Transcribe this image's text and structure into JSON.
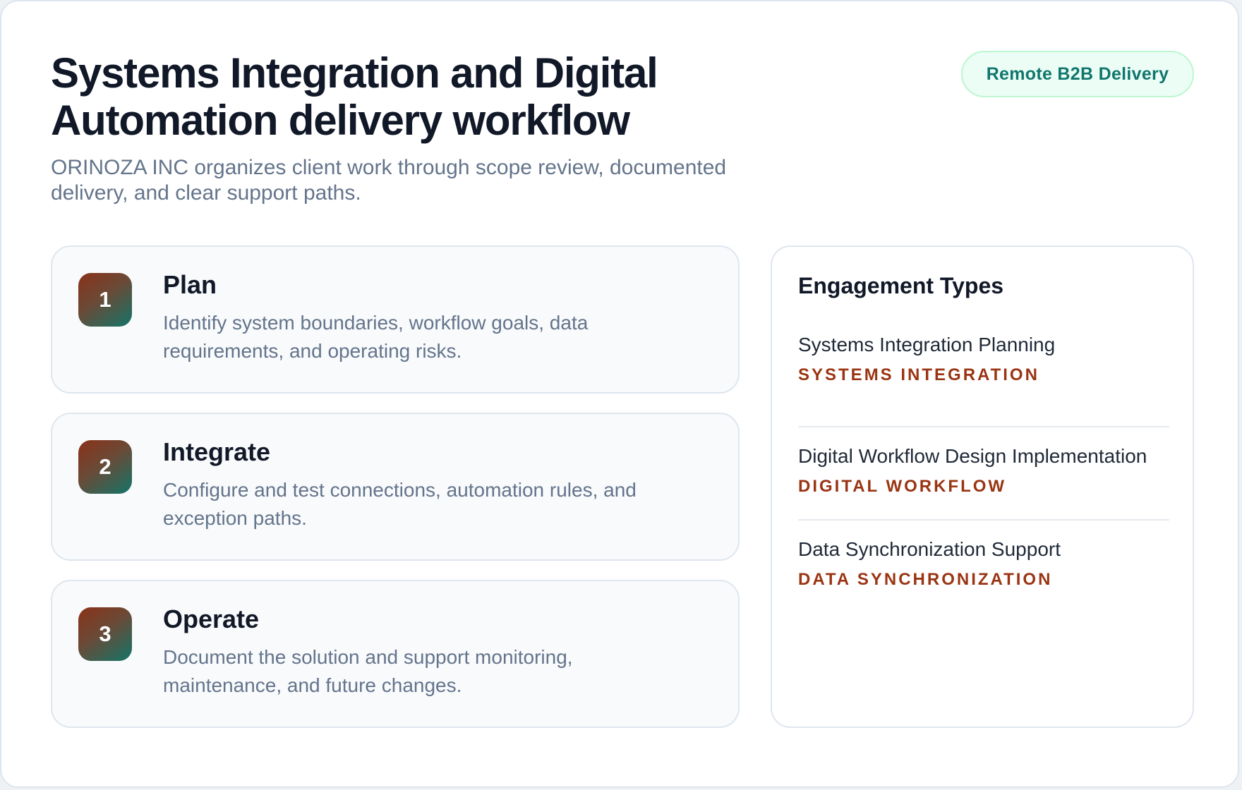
{
  "header": {
    "title": "Systems Integration and Digital Automation delivery workflow",
    "subtitle": "ORINOZA INC organizes client work through scope review, documented delivery, and clear support paths.",
    "badge": "Remote B2B Delivery"
  },
  "steps": [
    {
      "number": "1",
      "title": "Plan",
      "description": "Identify system boundaries, workflow goals, data requirements, and operating risks."
    },
    {
      "number": "2",
      "title": "Integrate",
      "description": "Configure and test connections, automation rules, and exception paths."
    },
    {
      "number": "3",
      "title": "Operate",
      "description": "Document the solution and support monitoring, maintenance, and future changes."
    }
  ],
  "engagements": {
    "title": "Engagement Types",
    "items": [
      {
        "name": "Systems Integration Planning",
        "category": "SYSTEMS INTEGRATION"
      },
      {
        "name": "Digital Workflow Design Implementation",
        "category": "DIGITAL WORKFLOW"
      },
      {
        "name": "Data Synchronization Support",
        "category": "DATA SYNCHRONIZATION"
      }
    ]
  },
  "colors": {
    "badge_text": "#0f766e",
    "badge_background": "#ecfdf5",
    "category_text": "#9a3412",
    "step_gradient_start": "#8b3218",
    "step_gradient_end": "#137468"
  }
}
